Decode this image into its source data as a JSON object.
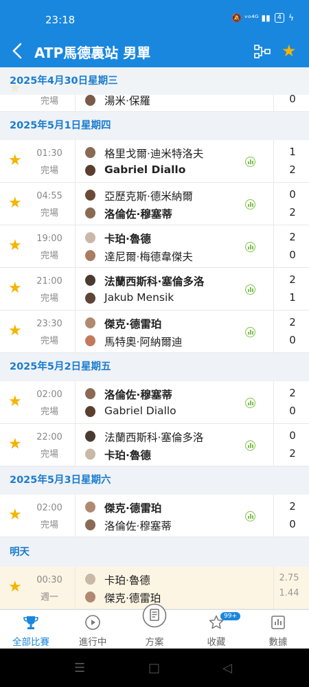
{
  "status_bar": {
    "time": "23:18",
    "icons": "🔕 ᵛᵒ⁴ᴳ ▮▮",
    "battery": "4"
  },
  "app_bar": {
    "title": "ATP馬德裏站 男單"
  },
  "colors": {
    "primary": "#1a87de",
    "favorite": "#f5b400",
    "stats": "#7cc24a"
  },
  "sections": [
    {
      "date": "2025年4月30日星期三",
      "partial_row": {
        "player2": "湯米·保羅",
        "score2": "0",
        "status": "完場"
      }
    },
    {
      "date": "2025年5月1日星期四",
      "matches": [
        {
          "time": "01:30",
          "status": "完場",
          "player1": "格里戈爾·迪米特洛夫",
          "player2": "Gabriel Diallo",
          "score1": "1",
          "score2": "2",
          "winner": 2
        },
        {
          "time": "04:55",
          "status": "完場",
          "player1": "亞歷克斯·德米納爾",
          "player2": "洛倫佐·穆塞蒂",
          "score1": "0",
          "score2": "2",
          "winner": 2
        },
        {
          "time": "19:00",
          "status": "完場",
          "player1": "卡珀·魯德",
          "player2": "達尼爾·梅德韋傑夫",
          "score1": "2",
          "score2": "0",
          "winner": 1
        },
        {
          "time": "21:00",
          "status": "完場",
          "player1": "法蘭西斯科·塞倫多洛",
          "player2": "Jakub Mensik",
          "score1": "2",
          "score2": "1",
          "winner": 1
        },
        {
          "time": "23:30",
          "status": "完場",
          "player1": "傑克·德雷珀",
          "player2": "馬特奧·阿納爾迪",
          "score1": "2",
          "score2": "0",
          "winner": 1
        }
      ]
    },
    {
      "date": "2025年5月2日星期五",
      "matches": [
        {
          "time": "02:00",
          "status": "完場",
          "player1": "洛倫佐·穆塞蒂",
          "player2": "Gabriel Diallo",
          "score1": "2",
          "score2": "0",
          "winner": 1
        },
        {
          "time": "22:00",
          "status": "完場",
          "player1": "法蘭西斯科·塞倫多洛",
          "player2": "卡珀·魯德",
          "score1": "0",
          "score2": "2",
          "winner": 2
        }
      ]
    },
    {
      "date": "2025年5月3日星期六",
      "matches": [
        {
          "time": "02:00",
          "status": "完場",
          "player1": "傑克·德雷珀",
          "player2": "洛倫佐·穆塞蒂",
          "score1": "2",
          "score2": "0",
          "winner": 1
        }
      ]
    },
    {
      "date": "明天",
      "upcoming": {
        "time": "00:30",
        "status": "週一",
        "player1": "卡珀·魯德",
        "player2": "傑克·德雷珀",
        "odds1": "2.75",
        "odds2": "1.44"
      }
    }
  ],
  "tabs": [
    {
      "label": "全部比賽",
      "icon": "trophy-icon",
      "active": true
    },
    {
      "label": "進行中",
      "icon": "play-circle-icon",
      "active": false
    },
    {
      "label": "方案",
      "icon": "document-icon",
      "active": false
    },
    {
      "label": "收藏",
      "icon": "star-outline-icon",
      "active": false,
      "badge": "99+"
    },
    {
      "label": "數據",
      "icon": "bar-chart-icon",
      "active": false
    }
  ]
}
